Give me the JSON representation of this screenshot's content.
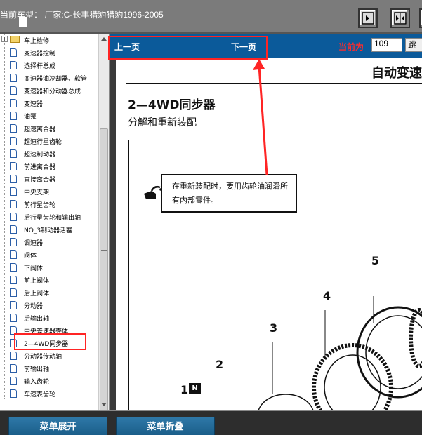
{
  "header": {
    "title": "当前车型： 厂家:C-长丰猎豹猎豹1996-2005"
  },
  "toolbar": {
    "buttons": [
      {
        "icon": "collapse-left-icon"
      },
      {
        "icon": "split-view-icon"
      },
      {
        "icon": "expand-view-icon"
      }
    ]
  },
  "tree": {
    "parent_label": "车上检修",
    "items": [
      "变速器控制",
      "选择杆总成",
      "变速器油冷却器、软管",
      "变速器和分动器总成",
      "变速器",
      "油泵",
      "超速离合器",
      "超速行星齿轮",
      "超速制动器",
      "前进离合器",
      "直接离合器",
      "中央支架",
      "前行星齿轮",
      "后行星齿轮和输出轴",
      "NO_3制动器活塞",
      "调速器",
      "阀体",
      "下阀体",
      "前上阀体",
      "后上阀体",
      "分动器",
      "后输出轴",
      "中央差速器壳体",
      "2—4WD同步器",
      "分动器传动轴",
      "前输出轴",
      "输入齿轮",
      "车速表齿轮"
    ],
    "selected_index": 23
  },
  "nav": {
    "prev": "上一页",
    "next": "下一页",
    "current_label": "当前为",
    "page_value": "109",
    "jump": "跳"
  },
  "document": {
    "header": "自动变速",
    "section_title": "2—4WD同步器",
    "section_sub": "分解和重新装配",
    "note": "在重新装配时，要用齿轮油润滑所有内部零件。",
    "part_numbers": [
      "5",
      "4",
      "3",
      "2",
      "1"
    ],
    "badge": "N"
  },
  "bottom": {
    "expand": "菜单展开",
    "collapse": "菜单折叠"
  },
  "colors": {
    "nav_bg": "#0b5a9a",
    "accent_red": "#ff2424",
    "menu_button": "#1a5d88"
  }
}
